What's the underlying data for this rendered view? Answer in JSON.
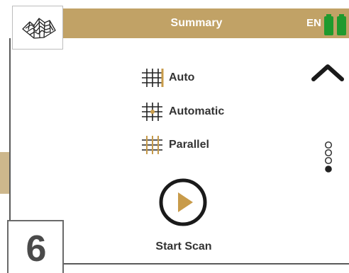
{
  "header": {
    "title": "Summary",
    "language": "EN",
    "color": "#c1a266"
  },
  "logo": {
    "icon": "terrain-logo-icon"
  },
  "modes": [
    {
      "label": "Auto",
      "icon": "grid-auto-icon"
    },
    {
      "label": "Automatic",
      "icon": "grid-automatic-icon"
    },
    {
      "label": "Parallel",
      "icon": "grid-parallel-icon"
    }
  ],
  "navigation": {
    "up_icon": "chevron-up-icon",
    "page_dots": 4,
    "active_dot": 4
  },
  "action": {
    "start_label": "Start Scan",
    "icon": "play-icon",
    "accent": "#c89b4a"
  },
  "step": {
    "number": "6"
  },
  "battery": {
    "color": "#1f9a2e",
    "cells": 2
  }
}
